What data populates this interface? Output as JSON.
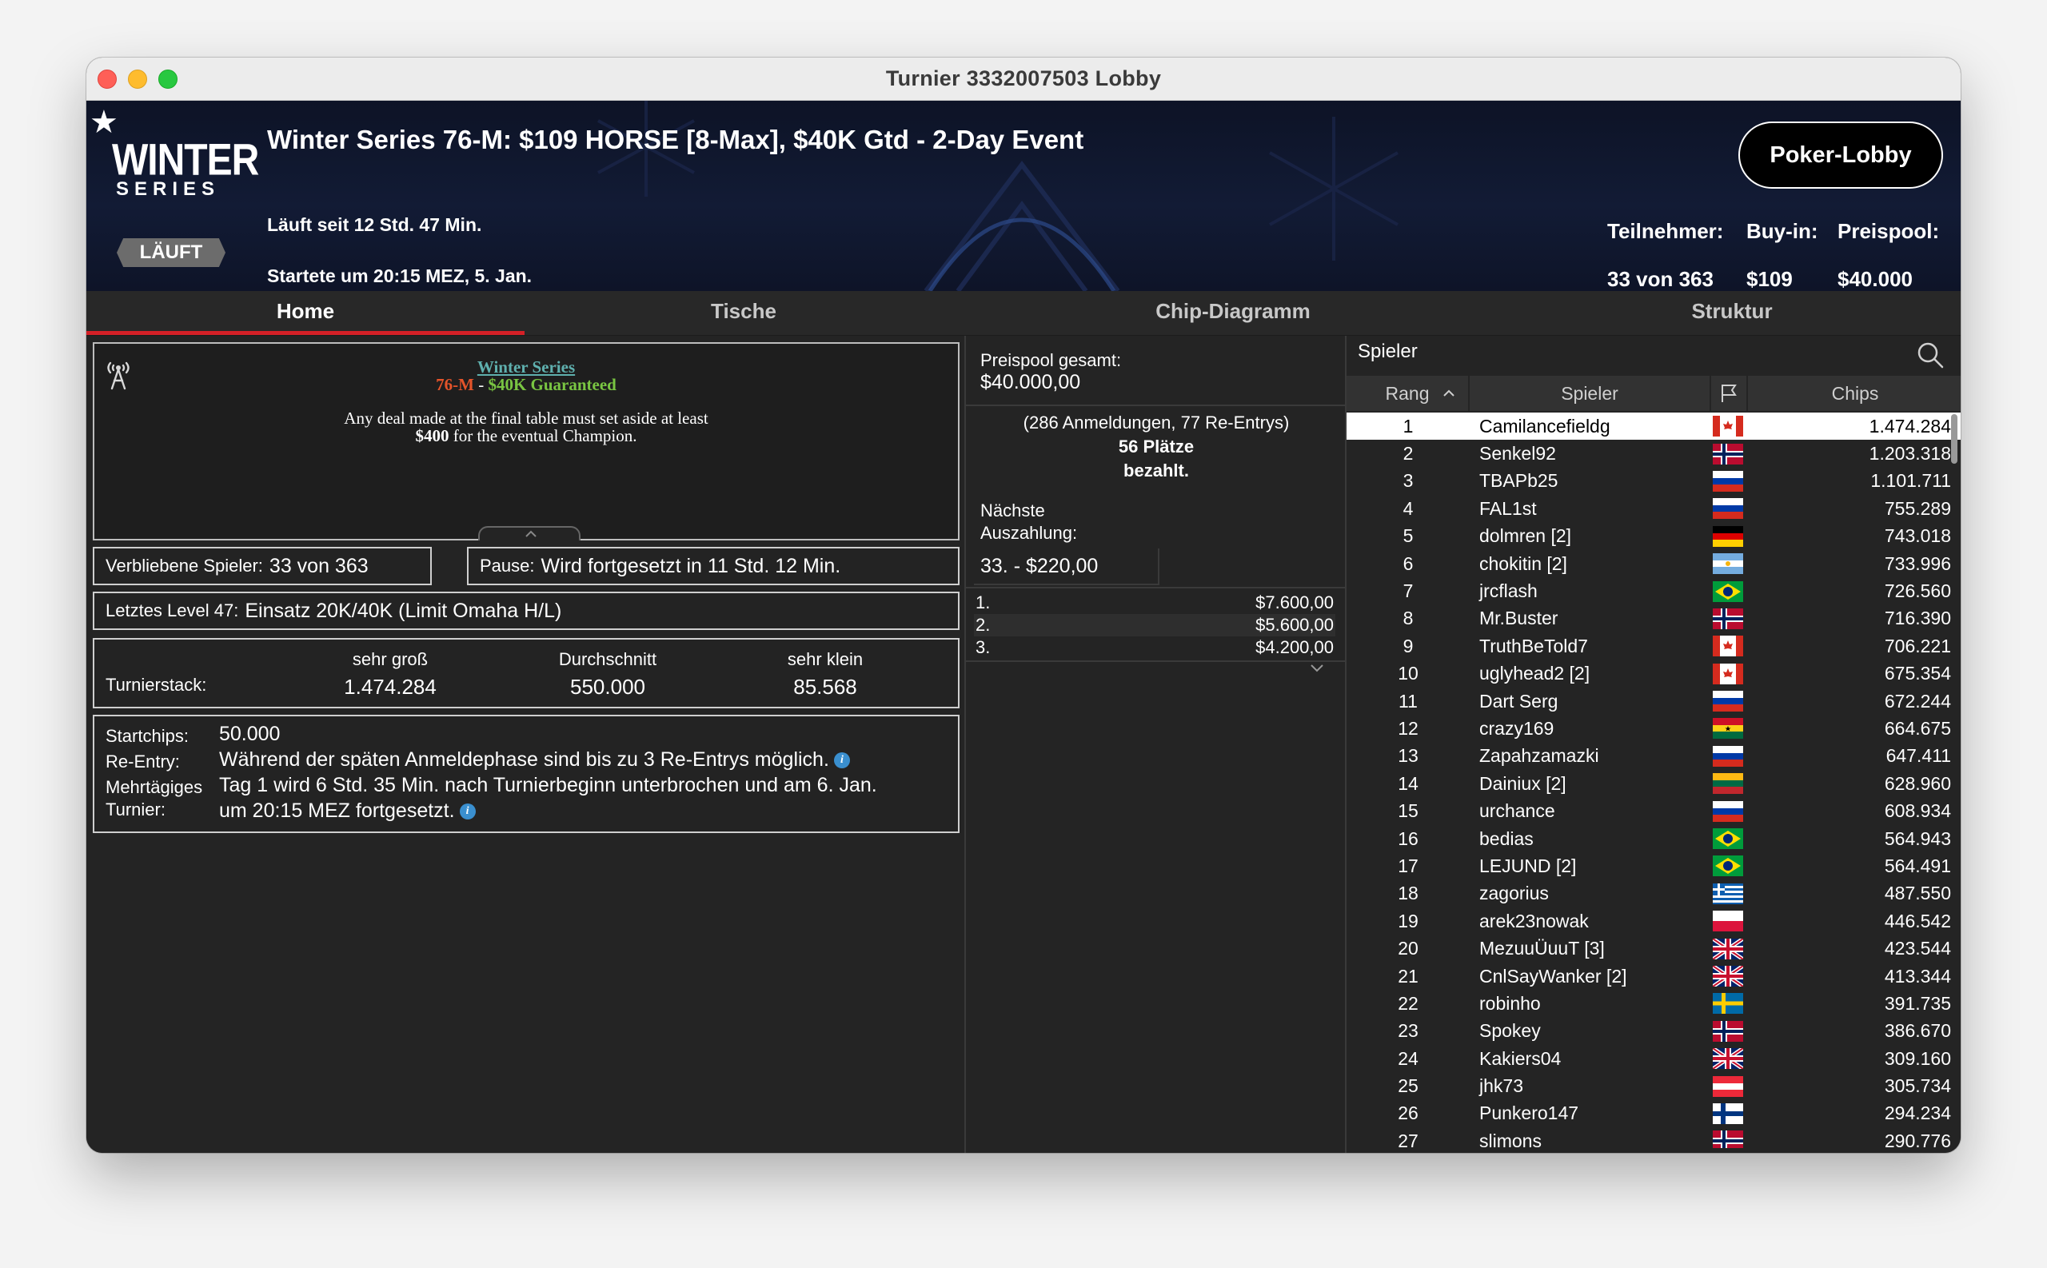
{
  "window": {
    "title": "Turnier 3332007503 Lobby"
  },
  "banner": {
    "logo_line1": "WINTER",
    "logo_line2": "SERIES",
    "status": "LÄUFT",
    "title": "Winter Series 76-M: $109 HORSE [8-Max], $40K Gtd - 2-Day Event",
    "running": "Läuft seit 12 Std. 47 Min.",
    "started": "Startete um 20:15 MEZ, 5. Jan.",
    "lobby_button": "Poker-Lobby",
    "participants_label": "Teilnehmer:",
    "participants_value": "33 von 363",
    "buyin_label": "Buy-in:",
    "buyin_value": "$109",
    "prizepool_label": "Preispool:",
    "prizepool_value": "$40.000"
  },
  "tabs": [
    {
      "label": "Home",
      "active": true
    },
    {
      "label": "Tische",
      "active": false
    },
    {
      "label": "Chip-Diagramm",
      "active": false
    },
    {
      "label": "Struktur",
      "active": false
    }
  ],
  "announcement": {
    "line1": "Winter Series",
    "line2a": "76-M",
    "line2sep": " - ",
    "line2b": "$40K Guaranteed",
    "body1": "Any deal made at the final table must set aside at least",
    "body2_bold": "$400",
    "body2_rest": " for the eventual Champion."
  },
  "home": {
    "remaining_label": "Verbliebene Spieler:",
    "remaining_value": "33 von 363",
    "pause_label": "Pause:",
    "pause_value": "Wird fortgesetzt in 11 Std. 12 Min.",
    "level_label": "Letztes Level 47:",
    "level_value": "Einsatz 20K/40K (Limit Omaha H/L)",
    "stack_label": "Turnierstack:",
    "stack_cols": [
      {
        "label": "sehr groß",
        "value": "1.474.284"
      },
      {
        "label": "Durchschnitt",
        "value": "550.000"
      },
      {
        "label": "sehr klein",
        "value": "85.568"
      }
    ],
    "startchips_label": "Startchips:",
    "startchips_value": "50.000",
    "reentry_label": "Re-Entry:",
    "reentry_value": "Während der späten Anmeldephase sind bis zu 3 Re-Entrys möglich.",
    "multiday_label1": "Mehrtägiges",
    "multiday_label2": "Turnier:",
    "multiday_value1": "Tag 1 wird 6 Std. 35 Min. nach Turnierbeginn unterbrochen und am 6. Jan.",
    "multiday_value2": "um 20:15 MEZ fortgesetzt."
  },
  "prize": {
    "total_label": "Preispool gesamt:",
    "total_value": "$40.000,00",
    "entries": "(286 Anmeldungen, 77 Re-Entrys)",
    "paid1": "56 Plätze",
    "paid2": "bezahlt.",
    "next_label1": "Nächste",
    "next_label2": "Auszahlung:",
    "next_value": "33. - $220,00",
    "payouts": [
      {
        "place": "1.",
        "amount": "$7.600,00"
      },
      {
        "place": "2.",
        "amount": "$5.600,00"
      },
      {
        "place": "3.",
        "amount": "$4.200,00"
      }
    ]
  },
  "players": {
    "label": "Spieler",
    "col_rank": "Rang",
    "col_player": "Spieler",
    "col_chips": "Chips",
    "rows": [
      {
        "rank": "1",
        "name": "Camilancefieldg",
        "flag": "ca",
        "chips": "1.474.284"
      },
      {
        "rank": "2",
        "name": "Senkel92",
        "flag": "no",
        "chips": "1.203.318"
      },
      {
        "rank": "3",
        "name": "TBAPb25",
        "flag": "ru",
        "chips": "1.101.711"
      },
      {
        "rank": "4",
        "name": "FAL1st",
        "flag": "ru",
        "chips": "755.289"
      },
      {
        "rank": "5",
        "name": "dolmren [2]",
        "flag": "de",
        "chips": "743.018"
      },
      {
        "rank": "6",
        "name": "chokitin [2]",
        "flag": "ar",
        "chips": "733.996"
      },
      {
        "rank": "7",
        "name": "jrcflash",
        "flag": "br",
        "chips": "726.560"
      },
      {
        "rank": "8",
        "name": "Mr.Buster",
        "flag": "no",
        "chips": "716.390"
      },
      {
        "rank": "9",
        "name": "TruthBeTold7",
        "flag": "ca",
        "chips": "706.221"
      },
      {
        "rank": "10",
        "name": "uglyhead2 [2]",
        "flag": "ca",
        "chips": "675.354"
      },
      {
        "rank": "11",
        "name": "Dart Serg",
        "flag": "ru",
        "chips": "672.244"
      },
      {
        "rank": "12",
        "name": "crazy169",
        "flag": "gh",
        "chips": "664.675"
      },
      {
        "rank": "13",
        "name": "Zapahzamazki",
        "flag": "ru",
        "chips": "647.411"
      },
      {
        "rank": "14",
        "name": "Dainiux [2]",
        "flag": "lt",
        "chips": "628.960"
      },
      {
        "rank": "15",
        "name": "urchance",
        "flag": "ru",
        "chips": "608.934"
      },
      {
        "rank": "16",
        "name": "bedias",
        "flag": "br",
        "chips": "564.943"
      },
      {
        "rank": "17",
        "name": "LEJUND [2]",
        "flag": "br",
        "chips": "564.491"
      },
      {
        "rank": "18",
        "name": "zagorius",
        "flag": "gr",
        "chips": "487.550"
      },
      {
        "rank": "19",
        "name": "arek23nowak",
        "flag": "pl",
        "chips": "446.542"
      },
      {
        "rank": "20",
        "name": "MezuuÜuuT [3]",
        "flag": "gb",
        "chips": "423.544"
      },
      {
        "rank": "21",
        "name": "CnlSayWanker [2]",
        "flag": "gb",
        "chips": "413.344"
      },
      {
        "rank": "22",
        "name": "robinho",
        "flag": "se",
        "chips": "391.735"
      },
      {
        "rank": "23",
        "name": "Spokey",
        "flag": "no",
        "chips": "386.670"
      },
      {
        "rank": "24",
        "name": "Kakiers04",
        "flag": "gb",
        "chips": "309.160"
      },
      {
        "rank": "25",
        "name": "jhk73",
        "flag": "at",
        "chips": "305.734"
      },
      {
        "rank": "26",
        "name": "Punkero147",
        "flag": "fi",
        "chips": "294.234"
      },
      {
        "rank": "27",
        "name": "slimons",
        "flag": "no",
        "chips": "290.776"
      }
    ]
  },
  "colors": {
    "accent": "#d42027",
    "selected_row": "#ffffff",
    "info_icon": "#3a8fcf"
  }
}
